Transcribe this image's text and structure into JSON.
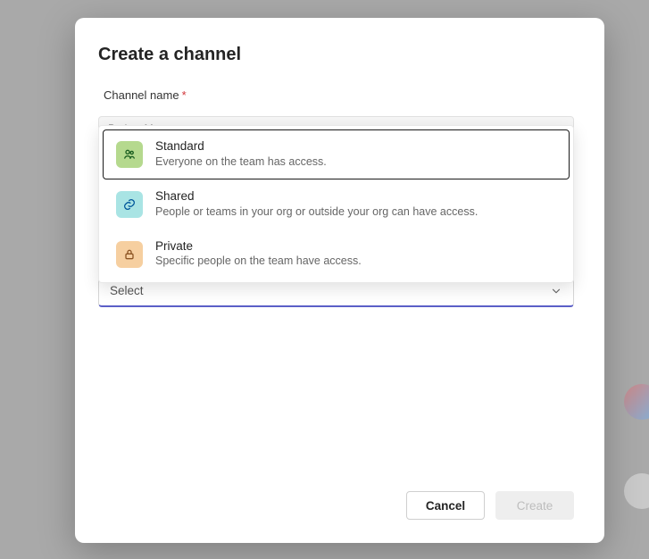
{
  "dialog": {
    "title": "Create a channel",
    "channel_name_label": "Channel name",
    "required_marker": "*",
    "peek_value": "Project M",
    "options": [
      {
        "key": "standard",
        "title": "Standard",
        "desc": "Everyone on the team has access."
      },
      {
        "key": "shared",
        "title": "Shared",
        "desc": "People or teams in your org or outside your org can have access."
      },
      {
        "key": "private",
        "title": "Private",
        "desc": "Specific people on the team have access."
      }
    ],
    "select_placeholder": "Select",
    "cancel_label": "Cancel",
    "create_label": "Create"
  },
  "icons": {
    "standard": "people-icon",
    "shared": "link-icon",
    "private": "lock-icon",
    "chevron": "chevron-down-icon"
  },
  "colors": {
    "accent": "#5b5fc7",
    "danger": "#d13438"
  }
}
